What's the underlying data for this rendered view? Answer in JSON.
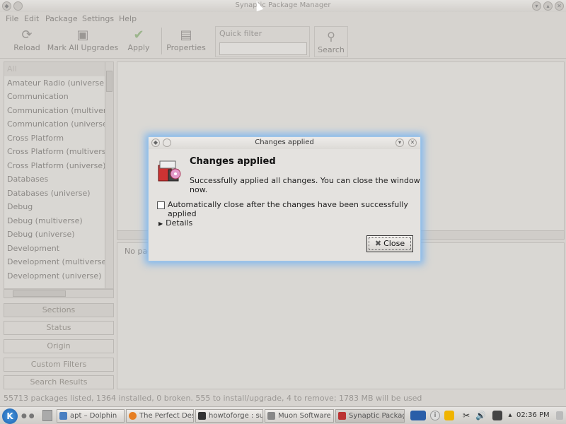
{
  "window": {
    "title": "Synaptic Package Manager"
  },
  "menu": [
    "File",
    "Edit",
    "Package",
    "Settings",
    "Help"
  ],
  "toolbar": {
    "reload": "Reload",
    "mark_all": "Mark All Upgrades",
    "apply": "Apply",
    "properties": "Properties",
    "quick_filter": "Quick filter",
    "search": "Search"
  },
  "sections": {
    "items": [
      "All",
      "Amateur Radio (universe)",
      "Communication",
      "Communication (multiverse)",
      "Communication (universe)",
      "Cross Platform",
      "Cross Platform (multiverse)",
      "Cross Platform (universe)",
      "Databases",
      "Databases (universe)",
      "Debug",
      "Debug (multiverse)",
      "Debug (universe)",
      "Development",
      "Development (multiverse)",
      "Development (universe)"
    ]
  },
  "filter_buttons": {
    "sections": "Sections",
    "status": "Status",
    "origin": "Origin",
    "custom": "Custom Filters",
    "search_results": "Search Results"
  },
  "details": {
    "text": "No package is selected."
  },
  "statusbar": "55713 packages listed, 1364 installed, 0 broken. 555 to install/upgrade, 4 to remove; 1783 MB will be used",
  "dialog": {
    "title": "Changes applied",
    "heading": "Changes applied",
    "message": "Successfully applied all changes. You can close the window now.",
    "auto_close_label": "Automatically close after the changes have been successfully applied",
    "auto_close_checked": false,
    "details_label": "Details",
    "close_label": "Close"
  },
  "taskbar": {
    "tasks": [
      "apt – Dolphin",
      "The Perfect Des",
      "howtoforge : su",
      "Muon Software",
      "Synaptic Packag"
    ],
    "clock": "02:36 PM"
  }
}
